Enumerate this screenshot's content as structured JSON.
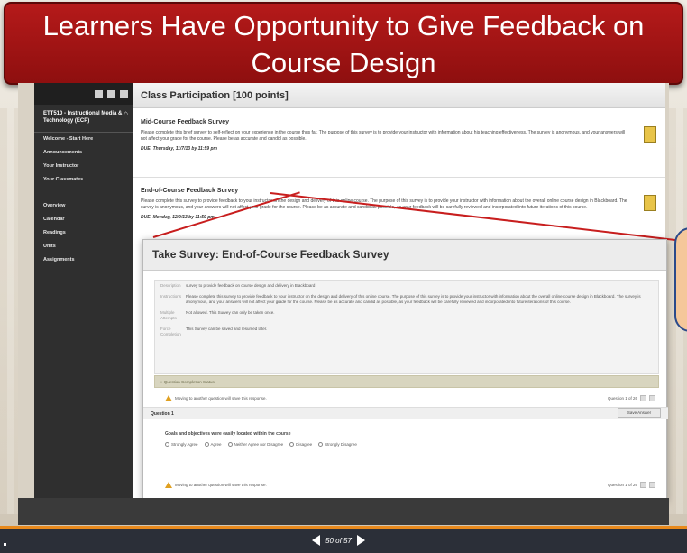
{
  "slide": {
    "title": "Learners Have Opportunity to Give Feedback on Course Design"
  },
  "sidebar": {
    "course": "ETT510 - Instructional Media & Technology (ECP)",
    "items": [
      {
        "label": "Welcome - Start Here"
      },
      {
        "label": "Announcements"
      },
      {
        "label": "Your Instructor"
      },
      {
        "label": "Your Classmates"
      }
    ],
    "items2": [
      {
        "label": "Overview"
      },
      {
        "label": "Calendar"
      },
      {
        "label": "Readings"
      },
      {
        "label": "Units"
      },
      {
        "label": "Assignments"
      }
    ]
  },
  "content": {
    "header": "Class Participation [100 points]",
    "mid_survey": {
      "title": "Mid-Course Feedback Survey",
      "body": "Please complete this brief survey to self-reflect on your experience in the course thus far. The purpose of this survey is to provide your instructor with information about his teaching effectiveness. The survey is anonymous, and your answers will not affect your grade for the course. Please be as accurate and candid as possible.",
      "due": "DUE: Thursday, 11/7/13 by 11:59 pm"
    },
    "end_survey": {
      "title": "End-of-Course Feedback Survey",
      "body": "Please complete this survey to provide feedback to your instructor on the design and delivery of this online course. The purpose of this survey is to provide your instructor with information about the overall online course design in Blackboard. The survey is anonymous, and your answers will not affect your grade for the course. Please be as accurate and candid as possible, as your feedback will be carefully reviewed and incorporated into future iterations of this course.",
      "due": "DUE: Monday, 12/9/13 by 11:59 pm"
    }
  },
  "survey": {
    "title": "Take Survey: End-of-Course Feedback Survey",
    "description_label": "Description",
    "description": "survey to provide feedback on course design and delivery in Blackboard",
    "instructions_label": "Instructions",
    "instructions": "Please complete this survey to provide feedback to your instructor on the design and delivery of this online course. The purpose of this survey is to provide your instructor with information about the overall online course design in Blackboard. The survey is anonymous, and your answers will not affect your grade for the course. Please be as accurate and candid as possible, as your feedback will be carefully reviewed and incorporated into future iterations of this course.",
    "attempts_label": "Multiple Attempts",
    "attempts": "Not allowed. This Survey can only be taken once.",
    "force_label": "Force Completion",
    "force": "This Survey can be saved and resumed later.",
    "status": "» Question Completion Status:",
    "warning": "Moving to another question will save this response.",
    "question_count": "Question 1 of 26",
    "question_label": "Question 1",
    "save_answer": "Save Answer",
    "question_text": "Goals and objectives were easily located within the course",
    "options": [
      "Strongly Agree",
      "Agree",
      "Neither Agree nor Disagree",
      "Disagree",
      "Strongly Disagree"
    ]
  },
  "player": {
    "page": "50 of 57"
  }
}
